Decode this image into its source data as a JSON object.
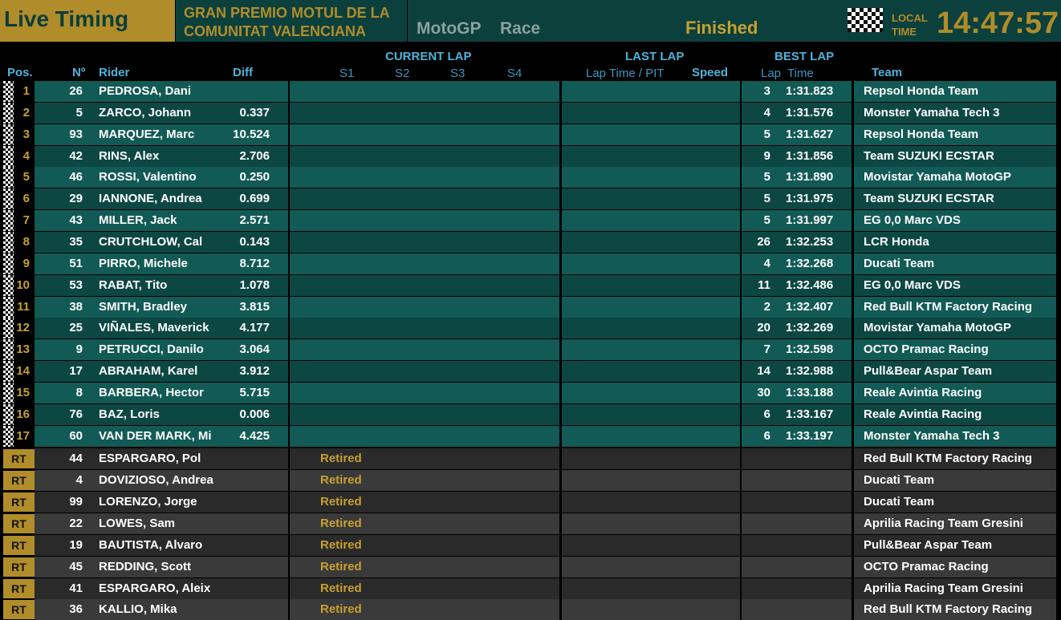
{
  "header": {
    "title": "Live Timing",
    "event_line1": "GRAN PREMIO MOTUL DE LA",
    "event_line2": "COMUNITAT VALENCIANA",
    "class": "MotoGP",
    "session": "Race",
    "status": "Finished",
    "local_label_line1": "LOCAL",
    "local_label_line2": "TIME",
    "local_time": "14:47:57"
  },
  "columns": {
    "pos": "Pos.",
    "num": "Nº",
    "rider": "Rider",
    "diff": "Diff",
    "current_lap": "CURRENT LAP",
    "s1": "S1",
    "s2": "S2",
    "s3": "S3",
    "s4": "S4",
    "last_lap": "LAST LAP",
    "lap_time_pit": "Lap Time / PIT",
    "speed": "Speed",
    "best_lap": "BEST LAP",
    "best_lap_no": "Lap",
    "best_time": "Time",
    "team": "Team"
  },
  "colors": {
    "row_teal_light": "#125a55",
    "row_teal_dark": "#0d4744",
    "row_gray_light": "#3a3a3a",
    "row_gray_dark": "#2a2a2a",
    "gold": "#b08d2a",
    "header_blue": "#4fb3d9"
  },
  "rows": [
    {
      "pos": "1",
      "num": "26",
      "rider": "PEDROSA, Dani",
      "diff": "",
      "best_lap": "3",
      "best_time": "1:31.823",
      "team": "Repsol Honda Team"
    },
    {
      "pos": "2",
      "num": "5",
      "rider": "ZARCO, Johann",
      "diff": "0.337",
      "best_lap": "4",
      "best_time": "1:31.576",
      "team": "Monster Yamaha Tech 3"
    },
    {
      "pos": "3",
      "num": "93",
      "rider": "MARQUEZ, Marc",
      "diff": "10.524",
      "best_lap": "5",
      "best_time": "1:31.627",
      "team": "Repsol Honda Team"
    },
    {
      "pos": "4",
      "num": "42",
      "rider": "RINS, Alex",
      "diff": "2.706",
      "best_lap": "9",
      "best_time": "1:31.856",
      "team": "Team SUZUKI ECSTAR"
    },
    {
      "pos": "5",
      "num": "46",
      "rider": "ROSSI, Valentino",
      "diff": "0.250",
      "best_lap": "5",
      "best_time": "1:31.890",
      "team": "Movistar Yamaha MotoGP"
    },
    {
      "pos": "6",
      "num": "29",
      "rider": "IANNONE, Andrea",
      "diff": "0.699",
      "best_lap": "5",
      "best_time": "1:31.975",
      "team": "Team SUZUKI ECSTAR"
    },
    {
      "pos": "7",
      "num": "43",
      "rider": "MILLER, Jack",
      "diff": "2.571",
      "best_lap": "5",
      "best_time": "1:31.997",
      "team": "EG 0,0 Marc VDS"
    },
    {
      "pos": "8",
      "num": "35",
      "rider": "CRUTCHLOW, Cal",
      "diff": "0.143",
      "best_lap": "26",
      "best_time": "1:32.253",
      "team": "LCR Honda"
    },
    {
      "pos": "9",
      "num": "51",
      "rider": "PIRRO, Michele",
      "diff": "8.712",
      "best_lap": "4",
      "best_time": "1:32.268",
      "team": "Ducati Team"
    },
    {
      "pos": "10",
      "num": "53",
      "rider": "RABAT, Tito",
      "diff": "1.078",
      "best_lap": "11",
      "best_time": "1:32.486",
      "team": "EG 0,0 Marc VDS"
    },
    {
      "pos": "11",
      "num": "38",
      "rider": "SMITH, Bradley",
      "diff": "3.815",
      "best_lap": "2",
      "best_time": "1:32.407",
      "team": "Red Bull KTM Factory Racing"
    },
    {
      "pos": "12",
      "num": "25",
      "rider": "VIÑALES, Maverick",
      "diff": "4.177",
      "best_lap": "20",
      "best_time": "1:32.269",
      "team": "Movistar Yamaha MotoGP"
    },
    {
      "pos": "13",
      "num": "9",
      "rider": "PETRUCCI, Danilo",
      "diff": "3.064",
      "best_lap": "7",
      "best_time": "1:32.598",
      "team": "OCTO Pramac Racing"
    },
    {
      "pos": "14",
      "num": "17",
      "rider": "ABRAHAM, Karel",
      "diff": "3.912",
      "best_lap": "14",
      "best_time": "1:32.988",
      "team": "Pull&Bear Aspar Team"
    },
    {
      "pos": "15",
      "num": "8",
      "rider": "BARBERA, Hector",
      "diff": "5.715",
      "best_lap": "30",
      "best_time": "1:33.188",
      "team": "Reale Avintia Racing"
    },
    {
      "pos": "16",
      "num": "76",
      "rider": "BAZ, Loris",
      "diff": "0.006",
      "best_lap": "6",
      "best_time": "1:33.167",
      "team": "Reale Avintia Racing"
    },
    {
      "pos": "17",
      "num": "60",
      "rider": "VAN DER MARK, Mi",
      "diff": "4.425",
      "best_lap": "6",
      "best_time": "1:33.197",
      "team": "Monster Yamaha Tech 3"
    }
  ],
  "retired_rows": [
    {
      "pos": "RT",
      "num": "44",
      "rider": "ESPARGARO, Pol",
      "status": "Retired",
      "team": "Red Bull KTM Factory Racing"
    },
    {
      "pos": "RT",
      "num": "4",
      "rider": "DOVIZIOSO, Andrea",
      "status": "Retired",
      "team": "Ducati Team"
    },
    {
      "pos": "RT",
      "num": "99",
      "rider": "LORENZO, Jorge",
      "status": "Retired",
      "team": "Ducati Team"
    },
    {
      "pos": "RT",
      "num": "22",
      "rider": "LOWES, Sam",
      "status": "Retired",
      "team": "Aprilia Racing Team Gresini"
    },
    {
      "pos": "RT",
      "num": "19",
      "rider": "BAUTISTA, Alvaro",
      "status": "Retired",
      "team": "Pull&Bear Aspar Team"
    },
    {
      "pos": "RT",
      "num": "45",
      "rider": "REDDING, Scott",
      "status": "Retired",
      "team": "OCTO Pramac Racing"
    },
    {
      "pos": "RT",
      "num": "41",
      "rider": "ESPARGARO, Aleix",
      "status": "Retired",
      "team": "Aprilia Racing Team Gresini"
    },
    {
      "pos": "RT",
      "num": "36",
      "rider": "KALLIO, Mika",
      "status": "Retired",
      "team": "Red Bull KTM Factory Racing"
    }
  ]
}
